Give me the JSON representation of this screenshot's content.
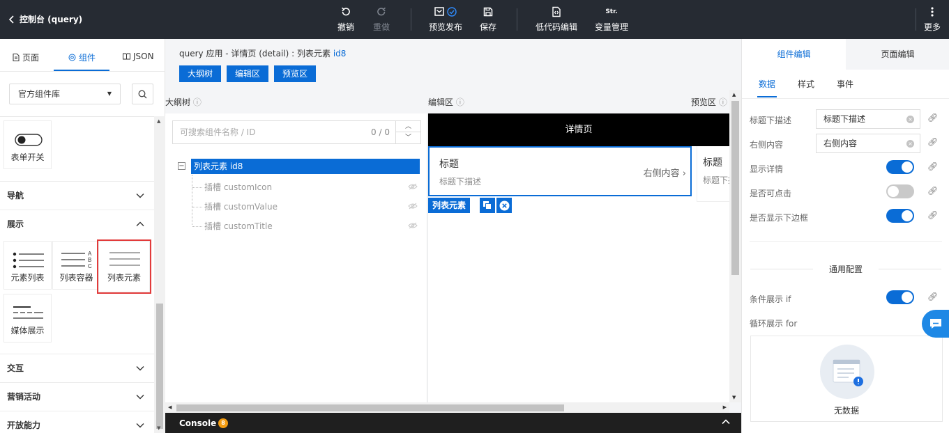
{
  "topbar": {
    "title": "控制台 (query)",
    "undo": "撤销",
    "redo": "重做",
    "preview_publish": "预览发布",
    "save": "保存",
    "lowcode": "低代码编辑",
    "var_mgmt": "变量管理",
    "var_icon_text": "Str.",
    "more": "更多"
  },
  "left": {
    "tabs": [
      "页面",
      "组件",
      "JSON"
    ],
    "library": "官方组件库",
    "items": {
      "form_switch": "表单开关",
      "element_list": "元素列表",
      "list_container": "列表容器",
      "list_element": "列表元素",
      "media_display": "媒体展示"
    },
    "sections": {
      "nav": "导航",
      "display": "展示",
      "interact": "交互",
      "marketing": "营销活动",
      "open": "开放能力"
    }
  },
  "main": {
    "crumb_prefix": "query 应用 - 详情页 (detail) : 列表元素",
    "crumb_id": "id8",
    "panel_buttons": [
      "大纲树",
      "编辑区",
      "预览区"
    ],
    "labels": {
      "outline": "大纲树",
      "editor": "编辑区",
      "preview": "预览区"
    },
    "outline": {
      "search_placeholder": "可搜索组件名称 / ID",
      "count": "0 / 0",
      "root": "列表元素 id8",
      "children": [
        "插槽 customIcon",
        "插槽 customValue",
        "插槽 customTitle"
      ]
    },
    "editor": {
      "header": "详情页",
      "title": "标题",
      "subtitle": "标题下描述",
      "right": "右侧内容",
      "tag": "列表元素"
    },
    "preview": {
      "title": "标题",
      "subtitle": "标题下描述"
    },
    "console": {
      "label": "Console",
      "badge": "8"
    }
  },
  "right": {
    "tabs": [
      "组件编辑",
      "页面编辑"
    ],
    "subtabs": [
      "数据",
      "样式",
      "事件"
    ],
    "fields": {
      "subtitle_label": "标题下描述",
      "subtitle_value": "标题下描述",
      "right_label": "右侧内容",
      "right_value": "右侧内容",
      "show_detail": "显示详情",
      "clickable": "是否可点击",
      "show_border": "是否显示下边框"
    },
    "toggles": {
      "show_detail": true,
      "clickable": false,
      "show_border": true,
      "cond_if": true
    },
    "general": "通用配置",
    "cond_if": "条件展示 if",
    "loop_for": "循环展示 for",
    "no_data": "无数据"
  }
}
